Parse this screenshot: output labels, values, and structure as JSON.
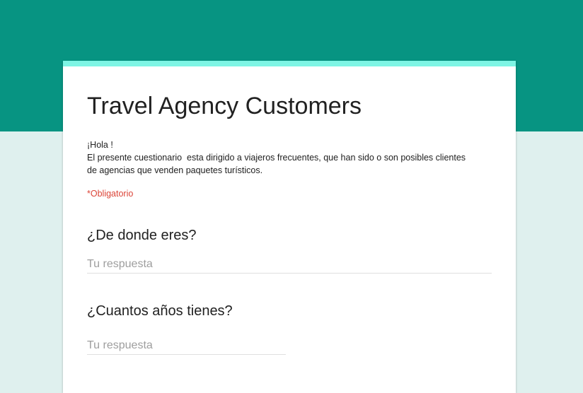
{
  "form": {
    "title": "Travel Agency Customers",
    "description_lines": [
      "¡Hola !",
      "El presente cuestionario  esta dirigido a viajeros frecuentes, que han sido o son posibles clientes",
      "de agencias que venden paquetes turísticos."
    ],
    "required_note": "*Obligatorio"
  },
  "questions": [
    {
      "title": "¿De donde eres?",
      "placeholder": "Tu respuesta",
      "value": ""
    },
    {
      "title": "¿Cuantos años tienes?",
      "placeholder": "Tu respuesta",
      "value": ""
    }
  ],
  "colors": {
    "header_band": "#079482",
    "accent": "#7ef5e4",
    "page_background": "#dff0ee",
    "required": "#db4437"
  }
}
